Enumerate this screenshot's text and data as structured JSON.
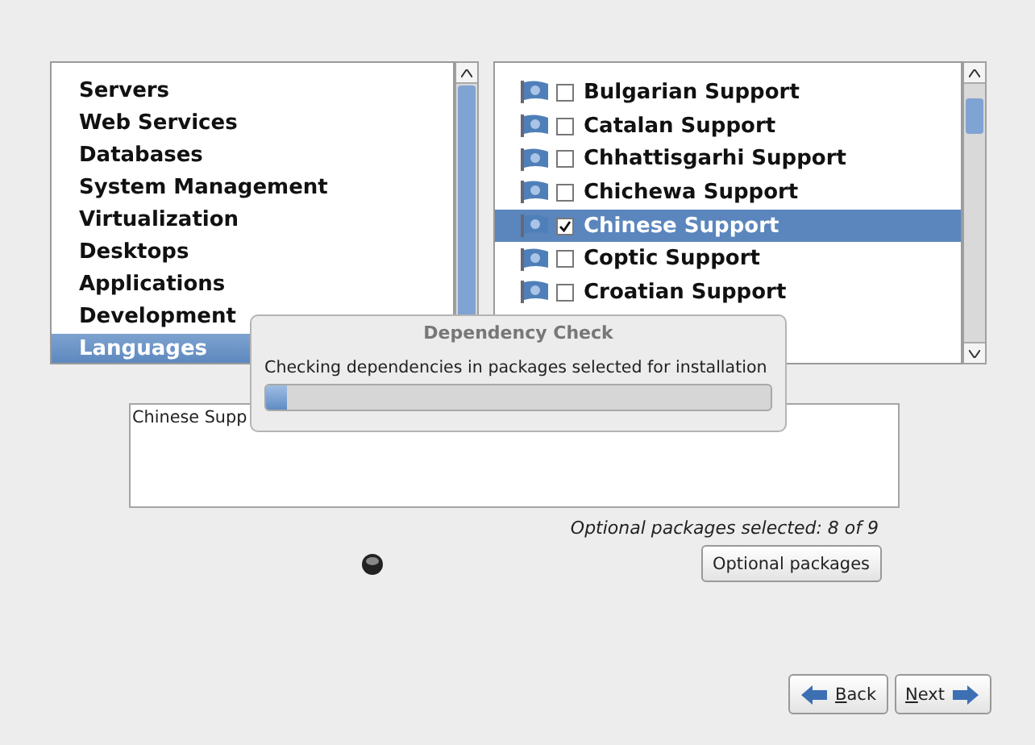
{
  "groups": [
    {
      "label": "Servers",
      "selected": false
    },
    {
      "label": "Web Services",
      "selected": false
    },
    {
      "label": "Databases",
      "selected": false
    },
    {
      "label": "System Management",
      "selected": false
    },
    {
      "label": "Virtualization",
      "selected": false
    },
    {
      "label": "Desktops",
      "selected": false
    },
    {
      "label": "Applications",
      "selected": false
    },
    {
      "label": "Development",
      "selected": false
    },
    {
      "label": "Languages",
      "selected": true
    }
  ],
  "packages": [
    {
      "label": "Bulgarian Support",
      "checked": false,
      "selected": false
    },
    {
      "label": "Catalan Support",
      "checked": false,
      "selected": false
    },
    {
      "label": "Chhattisgarhi Support",
      "checked": false,
      "selected": false
    },
    {
      "label": "Chichewa Support",
      "checked": false,
      "selected": false
    },
    {
      "label": "Chinese Support",
      "checked": true,
      "selected": true
    },
    {
      "label": "Coptic Support",
      "checked": false,
      "selected": false
    },
    {
      "label": "Croatian Support",
      "checked": false,
      "selected": false
    }
  ],
  "description": "Chinese Supp",
  "optional_count": "Optional packages selected: 8 of 9",
  "optional_button": "Optional packages",
  "dialog": {
    "title": "Dependency Check",
    "message": "Checking dependencies in packages selected for installation",
    "level": 0.04
  },
  "buttons": [
    {
      "label": "Back",
      "kind": "back"
    },
    {
      "label": "Next",
      "kind": "next"
    }
  ]
}
